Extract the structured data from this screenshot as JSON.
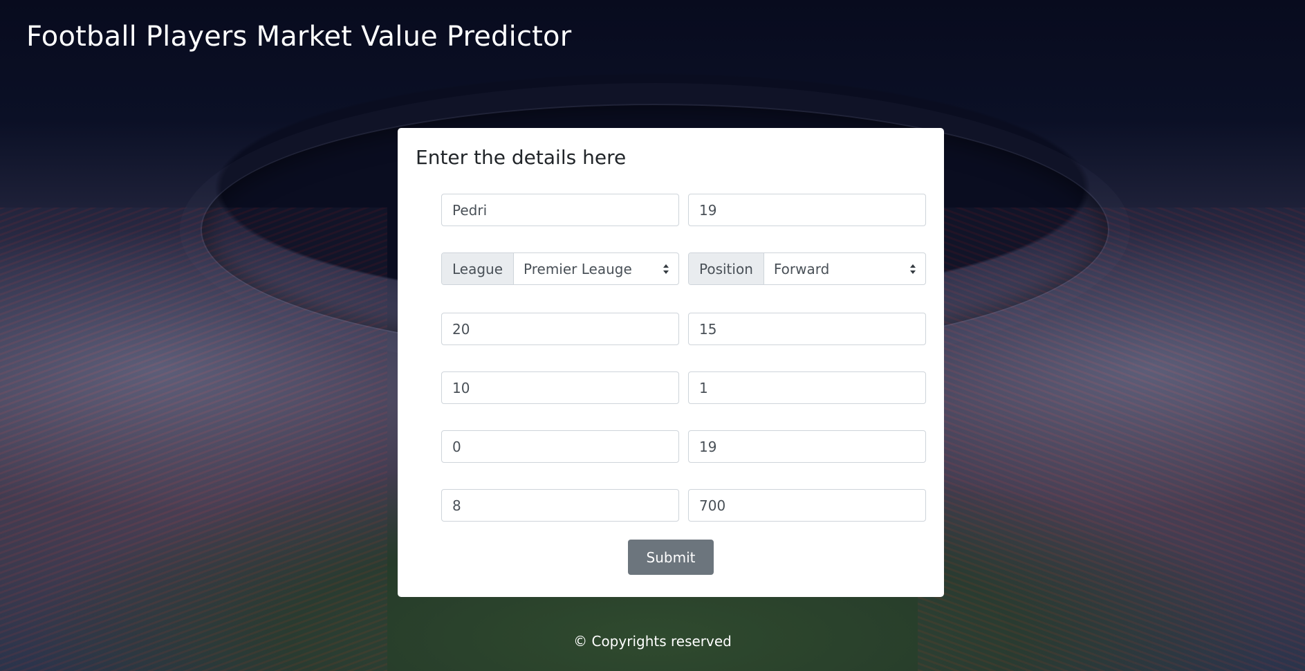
{
  "header": {
    "title": "Football Players Market Value Predictor"
  },
  "form": {
    "heading": "Enter the details here",
    "name_value": "Pedri",
    "age_value": "19",
    "league": {
      "label": "League",
      "selected": "Premier Leauge"
    },
    "position": {
      "label": "Position",
      "selected": "Forward"
    },
    "fields": {
      "r3c1": "20",
      "r3c2": "15",
      "r4c1": "10",
      "r4c2": "1",
      "r5c1": "0",
      "r5c2": "19",
      "r6c1": "8",
      "r6c2": "700"
    },
    "submit_label": "Submit"
  },
  "footer": {
    "text": "© Copyrights reserved"
  },
  "colors": {
    "background_dark": "#0b0f24",
    "card": "#ffffff",
    "button": "#6c757d",
    "addon": "#e9ecef",
    "border": "#ced4da"
  },
  "icons": {
    "select_caret": "sort-caret-icon"
  }
}
